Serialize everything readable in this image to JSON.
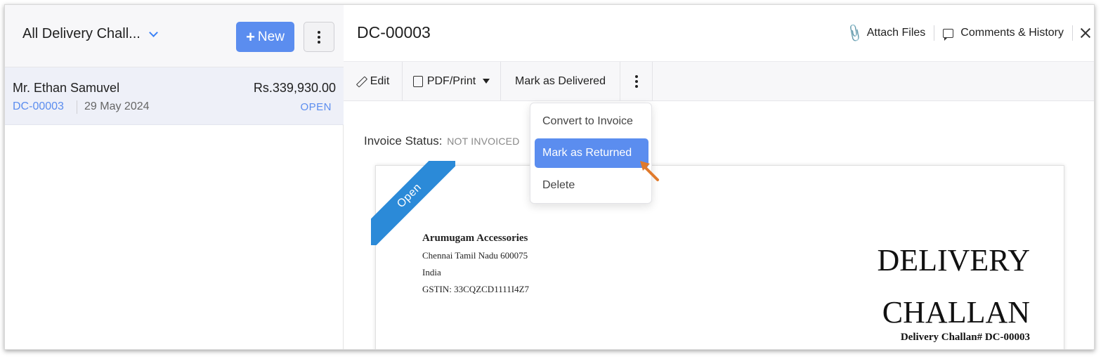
{
  "list": {
    "view_title": "All Delivery Chall...",
    "new_label": "New",
    "items": [
      {
        "customer": "Mr. Ethan Samuvel",
        "amount": "Rs.339,930.00",
        "number": "DC-00003",
        "date": "29 May 2024",
        "status": "OPEN"
      }
    ]
  },
  "detail": {
    "title": "DC-00003",
    "attach_label": "Attach Files",
    "comments_label": "Comments & History",
    "toolbar": {
      "edit": "Edit",
      "pdf_print": "PDF/Print",
      "mark_delivered": "Mark as Delivered"
    },
    "menu": {
      "convert": "Convert to Invoice",
      "mark_returned": "Mark as Returned",
      "delete": "Delete"
    },
    "invoice_status_label": "Invoice Status:",
    "invoice_status_value": "NOT INVOICED",
    "document": {
      "ribbon": "Open",
      "org_name": "Arumugam Accessories",
      "address_line1": "Chennai Tamil Nadu 600075",
      "address_line2": "India",
      "gstin": "GSTIN: 33CQZCD1111I4Z7",
      "heading_line1": "DELIVERY",
      "heading_line2": "CHALLAN",
      "number_line": "Delivery Challan# DC-00003"
    }
  },
  "colors": {
    "accent": "#5b8def",
    "ribbon": "#2b8ad8",
    "cursor": "#e07a2c"
  }
}
